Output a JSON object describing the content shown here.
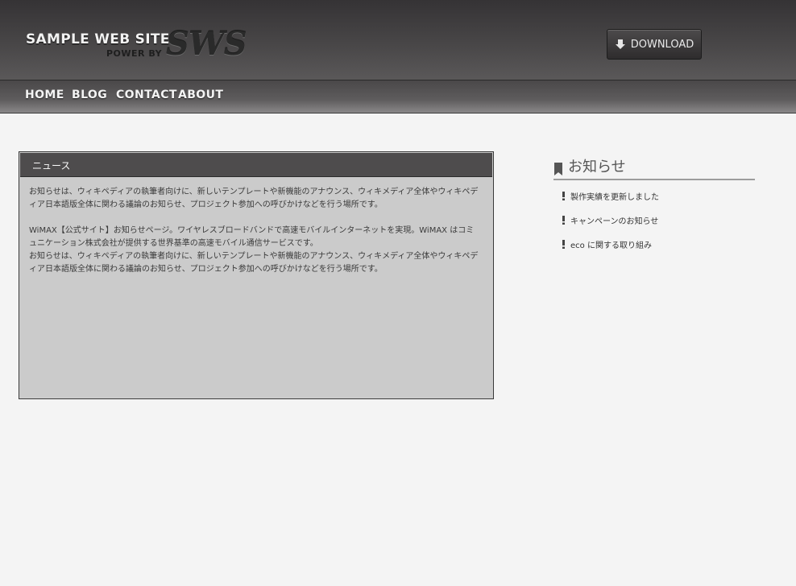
{
  "header": {
    "logo_main": "SAMPLE WEB SITE",
    "logo_sub": "POWER BY",
    "logo_mark": "SWS",
    "download_label": "DOWNLOAD",
    "download_icon": "down-arrow-icon"
  },
  "nav": {
    "items": [
      {
        "label": "HOME"
      },
      {
        "label": "BLOG"
      },
      {
        "label": "CONTACT"
      },
      {
        "label": "ABOUT"
      }
    ]
  },
  "news": {
    "title": "ニュース",
    "paragraphs": [
      "お知らせは、ウィキペディアの執筆者向けに、新しいテンプレートや新機能のアナウンス、ウィキメディア全体やウィキペディア日本語版全体に関わる議論のお知らせ、プロジェクト参加への呼びかけなどを行う場所です。",
      "WiMAX【公式サイト】お知らせページ。ワイヤレスブロードバンドで高速モバイルインターネットを実現。WiMAX はコミュニケーション株式会社が提供する世界基準の高速モバイル通信サービスです。",
      "お知らせは、ウィキペディアの執筆者向けに、新しいテンプレートや新機能のアナウンス、ウィキメディア全体やウィキペディア日本語版全体に関わる議論のお知らせ、プロジェクト参加への呼びかけなどを行う場所です。"
    ]
  },
  "sidebar": {
    "title": "お知らせ",
    "title_icon": "bookmark-icon",
    "item_icon": "exclamation-icon",
    "items": [
      {
        "label": "製作実績を更新しました"
      },
      {
        "label": "キャンペーンのお知らせ"
      },
      {
        "label": "eco に関する取り組み"
      }
    ]
  },
  "colors": {
    "header_bg": "#3f3d3e",
    "nav_bg": "#5a5859",
    "page_bg": "#f4f4f4",
    "panel_bg": "#cbcbcb",
    "panel_head_bg": "#4e4c4d"
  }
}
